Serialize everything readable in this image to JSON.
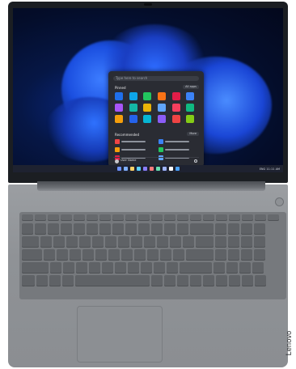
{
  "device": {
    "brand": "Lenovo"
  },
  "screen": {
    "start_menu": {
      "search_placeholder": "Type here to search",
      "pinned_label": "Pinned",
      "pinned_button": "All apps",
      "recommended_label": "Recommended",
      "recommended_button": "More",
      "user_name": "User Name"
    },
    "taskbar": {
      "tray_text": "ENG 11:11 AM"
    }
  },
  "colors": {
    "app_icons": [
      "#1f6feb",
      "#0ea5e9",
      "#22c55e",
      "#f97316",
      "#e11d48",
      "#3b82f6",
      "#a855f7",
      "#14b8a6",
      "#eab308",
      "#60a5fa",
      "#f43f5e",
      "#10b981",
      "#f59e0b",
      "#2563eb",
      "#06b6d4",
      "#8b5cf6",
      "#ef4444",
      "#84cc16"
    ],
    "rec_icons": [
      "#ef4444",
      "#3b82f6",
      "#f59e0b",
      "#22c55e",
      "#e11d48",
      "#60a5fa"
    ],
    "taskbar_icons": [
      "#6f93ff",
      "#7fb0ff",
      "#ffd166",
      "#5ad1ff",
      "#8a7dff",
      "#ff7b7b",
      "#68e0b0",
      "#9fb4ff",
      "#ffffff",
      "#4aa3ff"
    ]
  }
}
